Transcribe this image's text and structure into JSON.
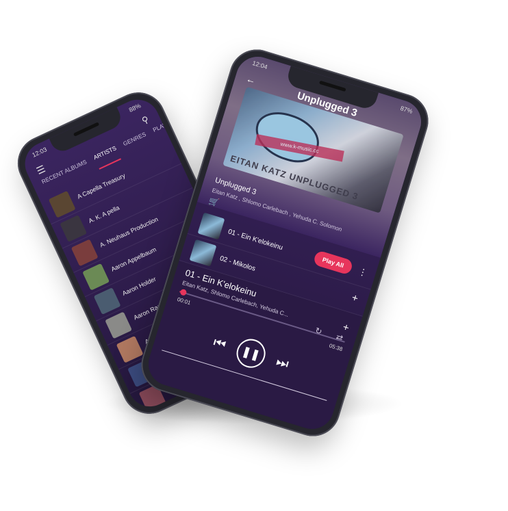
{
  "left_phone": {
    "status": {
      "time": "12:03",
      "battery": "88%"
    },
    "menu_icon": "hamburger-icon",
    "search_icon": "search-icon",
    "tabs": [
      {
        "label": "RECENT ALBUMS",
        "active": false
      },
      {
        "label": "ARTISTS",
        "active": true
      },
      {
        "label": "GENRES",
        "active": false
      },
      {
        "label": "PLAYLI",
        "active": false
      }
    ],
    "artists": [
      {
        "name": "A Capella Treasury",
        "thumb_color": "#5a4632"
      },
      {
        "name": "A. K. A pella",
        "thumb_color": "#3a3540"
      },
      {
        "name": "A. Neuhaus Production",
        "thumb_color": "#7a3d3d"
      },
      {
        "name": "Aaron Appelbaum",
        "thumb_color": "#6b8a55"
      },
      {
        "name": "Aaron Holder",
        "thumb_color": "#4a5c70"
      },
      {
        "name": "Aaron Razel",
        "thumb_color": "#8a8a88"
      },
      {
        "name": "Aaron Sh",
        "thumb_color": "#b07860"
      },
      {
        "name": "",
        "thumb_color": "#3c4c80"
      },
      {
        "name": "",
        "thumb_color": "#8a4a5a"
      }
    ]
  },
  "right_phone": {
    "status": {
      "time": "12:04",
      "battery": "87%"
    },
    "header_title": "Unplugged 3",
    "cover_banner": "www.k-music.cc",
    "cover_text": "EITAN KATZ UNPLUGGED 3",
    "album_name": "Unplugged 3",
    "album_artists": "Eitan Katz , Shlomo Carlebach , Yehuda C. Solomon",
    "play_all_label": "Play All",
    "tracks": [
      {
        "title": "01 - Ein K'elokeinu"
      },
      {
        "title": "02 - Mikolos"
      }
    ],
    "now_playing": {
      "title": "01 - Ein K'elokeinu",
      "artists": "Eitan Katz, Shlomo Carlebach, Yehuda C...",
      "elapsed": "00:01",
      "duration": "05:38",
      "progress": 0.01
    },
    "accent_color": "#e7355c"
  }
}
